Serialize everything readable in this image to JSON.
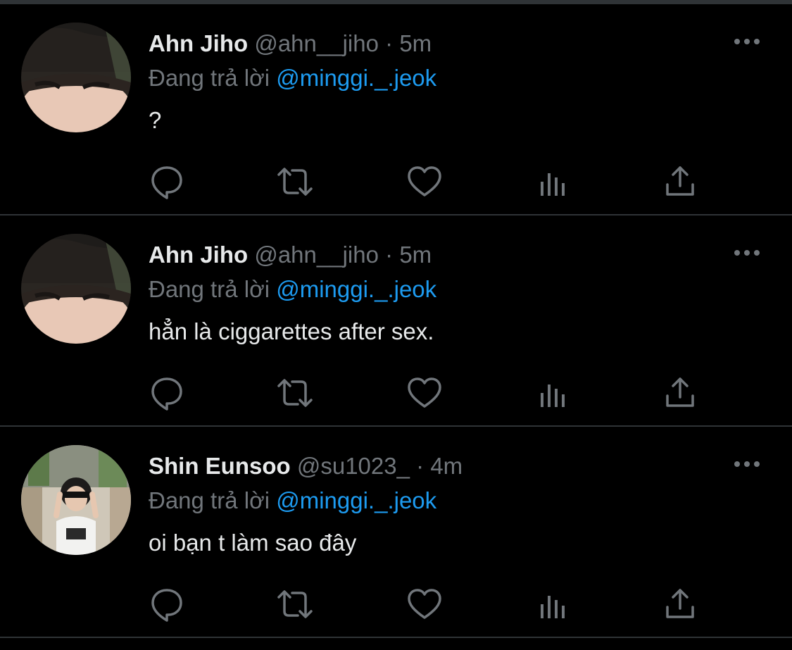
{
  "colors": {
    "background": "#000000",
    "divider": "#2f3336",
    "name": "#e7e9ea",
    "secondary": "#71767b",
    "mention": "#1d9bf0"
  },
  "reply_prefix": "Đang trả lời",
  "tweets": [
    {
      "name": "Ahn Jiho",
      "handle": "@ahn__jiho",
      "separator": "·",
      "time": "5m",
      "reply_prefix": "Đang trả lời",
      "reply_to": "@minggi._.jeok",
      "text": "?",
      "avatar_icon": "profile-photo"
    },
    {
      "name": "Ahn Jiho",
      "handle": "@ahn__jiho",
      "separator": "·",
      "time": "5m",
      "reply_prefix": "Đang trả lời",
      "reply_to": "@minggi._.jeok",
      "text": "hẳn là ciggarettes after sex.",
      "avatar_icon": "profile-photo"
    },
    {
      "name": "Shin Eunsoo",
      "handle": "@su1023_",
      "separator": "·",
      "time": "4m",
      "reply_prefix": "Đang trả lời",
      "reply_to": "@minggi._.jeok",
      "text": "oi bạn t làm sao đây",
      "avatar_icon": "profile-photo"
    }
  ],
  "icons": {
    "more": "more-horizontal-icon",
    "reply": "reply-bubble-icon",
    "retweet": "retweet-icon",
    "like": "heart-icon",
    "views": "analytics-bars-icon",
    "share": "share-upload-icon"
  }
}
